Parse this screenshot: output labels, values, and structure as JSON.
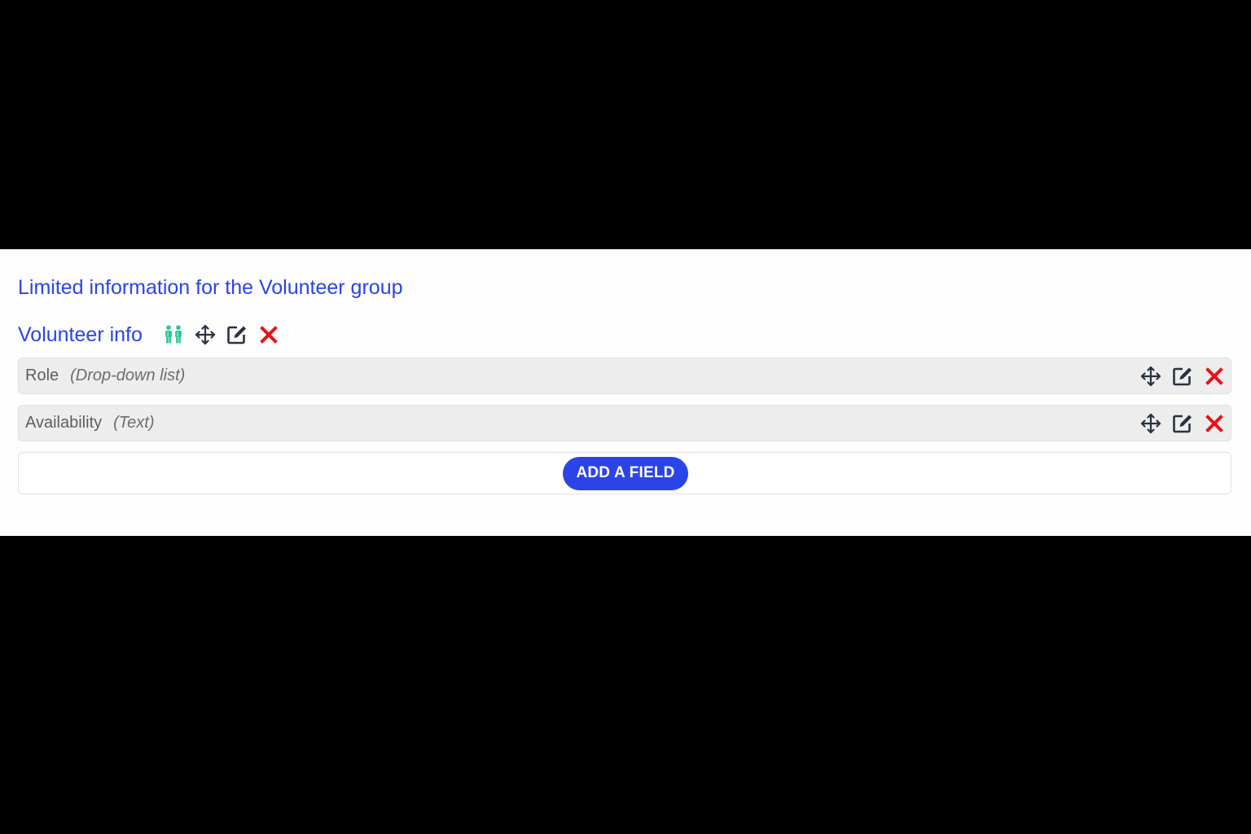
{
  "section": {
    "heading": "Limited information for the Volunteer group"
  },
  "group": {
    "title": "Volunteer info",
    "icons": [
      "group-people-icon",
      "move-icon",
      "edit-icon",
      "delete-icon"
    ]
  },
  "fields": [
    {
      "name": "Role",
      "type": "(Drop-down list)"
    },
    {
      "name": "Availability",
      "type": "(Text)"
    }
  ],
  "field_actions": [
    "move-icon",
    "edit-icon",
    "delete-icon"
  ],
  "add_field": {
    "label": "ADD A FIELD"
  },
  "colors": {
    "accent_blue": "#2b44e8",
    "group_icon_teal": "#1fc79a",
    "delete_red": "#e8121b",
    "icon_dark": "#2a3140",
    "field_bg": "#ededee"
  }
}
